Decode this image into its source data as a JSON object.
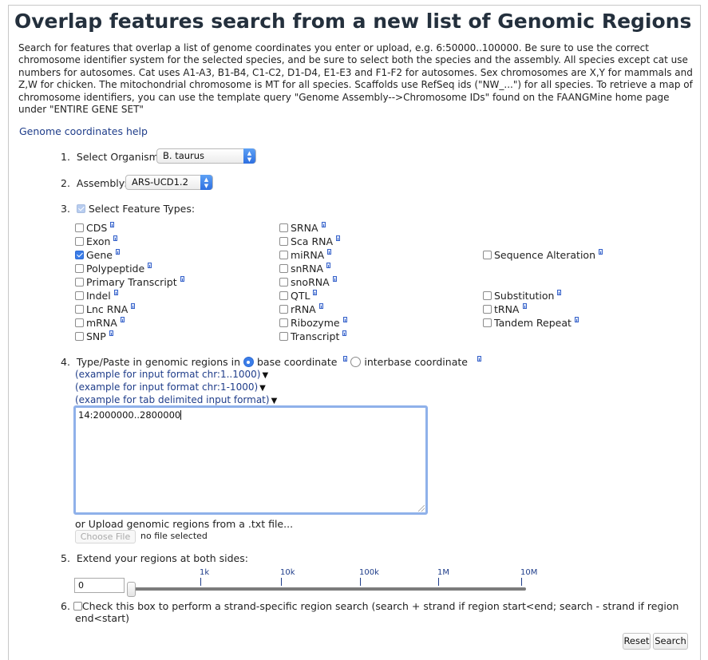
{
  "page_title": "Overlap features search from a new list of Genomic Regions",
  "intro": "Search for features that overlap a list of genome coordinates you enter or upload, e.g. 6:50000..100000. Be sure to use the correct chromosome identifier system for the selected species, and be sure to select both the species and the assembly. All species except cat use numbers for autosomes. Cat uses A1-A3, B1-B4, C1-C2, D1-D4, E1-E3 and F1-F2 for autosomes. Sex chromosomes are X,Y for mammals and Z,W for chicken. The mitochondrial chromosome is MT for all species. Scaffolds use RefSeq ids (\"NW_...\") for all species. To retrieve a map of chromosome identifiers, you can use the template query \"Genome Assembly-->Chromosome IDs\" found on the FAANGMine home page under \"ENTIRE GENE SET\"",
  "help_link": "Genome coordinates help",
  "steps": {
    "organism": {
      "number": "1.",
      "label": "Select Organism:",
      "value": "B. taurus"
    },
    "assembly": {
      "number": "2.",
      "label": "Assembly:",
      "value": "ARS-UCD1.2"
    },
    "feature_types": {
      "number": "3.",
      "label": "Select Feature Types:"
    },
    "regions": {
      "number": "4.",
      "label": "Type/Paste in genomic regions in",
      "base_label": "base coordinate",
      "interbase_label": "interbase coordinate",
      "examples": [
        "(example for input format chr:1..1000)",
        "(example for input format chr:1-1000)",
        "(example for tab delimited input format)"
      ],
      "text_value": "14:2000000..2800000",
      "upload_label": "or Upload genomic regions from a .txt file...",
      "file_button": "Choose File",
      "file_status": "no file selected"
    },
    "extend": {
      "number": "5.",
      "label": "Extend your regions at both sides:",
      "input_value": "0",
      "slider_value": 0,
      "ticks": [
        "1k",
        "10k",
        "100k",
        "1M",
        "10M"
      ]
    },
    "strand": {
      "number": "6.",
      "label_line1": "Check this box to perform a strand-specific region search (search + strand if region start<end; search - strand if region",
      "label_line2": "end<start)"
    }
  },
  "feature_types": {
    "col1": [
      {
        "label": "CDS",
        "checked": false
      },
      {
        "label": "Exon",
        "checked": false
      },
      {
        "label": "Gene",
        "checked": true
      },
      {
        "label": "Polypeptide",
        "checked": false
      },
      {
        "label": "Primary Transcript",
        "checked": false
      },
      {
        "label": "Indel",
        "checked": false
      },
      {
        "label": "Lnc RNA",
        "checked": false
      },
      {
        "label": "mRNA",
        "checked": false
      },
      {
        "label": "SNP",
        "checked": false
      }
    ],
    "col2": [
      {
        "label": "SRNA",
        "checked": false
      },
      {
        "label": "Sca RNA",
        "checked": false
      },
      {
        "label": "miRNA",
        "checked": false
      },
      {
        "label": "snRNA",
        "checked": false
      },
      {
        "label": "snoRNA",
        "checked": false
      },
      {
        "label": "QTL",
        "checked": false
      },
      {
        "label": "rRNA",
        "checked": false
      },
      {
        "label": "Ribozyme",
        "checked": false
      },
      {
        "label": "Transcript",
        "checked": false
      }
    ],
    "col3": [
      {
        "label": "Sequence Alteration",
        "checked": false
      },
      {
        "label": "Substitution",
        "checked": false
      },
      {
        "label": "tRNA",
        "checked": false
      },
      {
        "label": "Tandem Repeat",
        "checked": false
      }
    ]
  },
  "buttons": {
    "reset": "Reset",
    "search": "Search"
  },
  "colors": {
    "title": "#24303d",
    "link": "#1f3d8a",
    "accent": "#3b7de8"
  }
}
